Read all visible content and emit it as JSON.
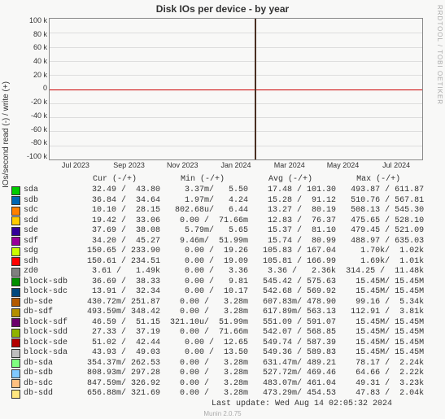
{
  "title": "Disk IOs per device - by year",
  "watermark": "RRDTOOL / TOBI OETIKER",
  "ylabel": "IOs/second read (-) / write (+)",
  "footer": "Munin 2.0.75",
  "last_update": "Last update: Wed Aug 14 02:05:32 2024",
  "chart_data": {
    "type": "line",
    "title": "Disk IOs per device - by year",
    "xlabel": "",
    "ylabel": "IOs/second read (-) / write (+)",
    "ylim": [
      -100000,
      100000
    ],
    "x_ticks": [
      "Jul 2023",
      "Sep 2023",
      "Nov 2023",
      "Jan 2024",
      "Mar 2024",
      "May 2024",
      "Jul 2024"
    ],
    "y_ticks": [
      "100 k",
      "80 k",
      "60 k",
      "40 k",
      "20 k",
      "0",
      "-20 k",
      "-40 k",
      "-60 k",
      "-80 k",
      "-100 k"
    ],
    "series": [
      {
        "name": "sda",
        "color": "#00cc00",
        "cur": "32.49 /  43.80",
        "min": "3.37m/   5.50",
        "avg": "17.48 / 101.30",
        "max": "493.87 / 611.87"
      },
      {
        "name": "sdb",
        "color": "#0066b3",
        "cur": "36.84 /  34.64",
        "min": "1.97m/   4.24",
        "avg": "15.28 /  91.12",
        "max": "510.76 / 567.81"
      },
      {
        "name": "sdc",
        "color": "#ff8000",
        "cur": "10.10 /  28.15",
        "min": "802.68u/   6.44",
        "avg": "13.27 /  80.19",
        "max": "508.13 / 545.30"
      },
      {
        "name": "sdd",
        "color": "#ffcc00",
        "cur": "19.42 /  33.06",
        "min": "0.00 /  71.66m",
        "avg": "12.83 /  76.37",
        "max": "475.65 / 528.10"
      },
      {
        "name": "sde",
        "color": "#330099",
        "cur": "37.69 /  38.08",
        "min": "5.79m/   5.65",
        "avg": "15.37 /  81.10",
        "max": "479.45 / 521.09"
      },
      {
        "name": "sdf",
        "color": "#990099",
        "cur": "34.20 /  45.27",
        "min": "9.46m/  51.99m",
        "avg": "15.74 /  80.99",
        "max": "488.97 / 635.03"
      },
      {
        "name": "sdg",
        "color": "#ccff00",
        "cur": "150.65 / 233.90",
        "min": "0.00 /  19.26",
        "avg": "105.83 / 167.04",
        "max": "1.70k/  1.02k"
      },
      {
        "name": "sdh",
        "color": "#ff0000",
        "cur": "150.61 / 234.51",
        "min": "0.00 /  19.09",
        "avg": "105.81 / 166.99",
        "max": "1.69k/  1.01k"
      },
      {
        "name": "zd0",
        "color": "#808080",
        "cur": "3.61 /   1.49k",
        "min": "0.00 /   3.36",
        "avg": "3.36 /   2.36k",
        "max": "314.25 /  11.48k"
      },
      {
        "name": "block-sdb",
        "color": "#008f00",
        "cur": "36.69 /  38.33",
        "min": "0.00 /   9.81",
        "avg": "545.42 / 575.63",
        "max": "15.45M/ 15.45M"
      },
      {
        "name": "block-sdc",
        "color": "#00487d",
        "cur": "13.91 /  32.34",
        "min": "0.00 /  10.17",
        "avg": "542.68 / 569.92",
        "max": "15.45M/ 15.45M"
      },
      {
        "name": "db-sde",
        "color": "#b35a00",
        "cur": "430.72m/ 251.87",
        "min": "0.00 /   3.28m",
        "avg": "607.83m/ 478.90",
        "max": "99.16 /  5.34k"
      },
      {
        "name": "db-sdf",
        "color": "#b38f00",
        "cur": "493.59m/ 348.42",
        "min": "0.00 /   3.28m",
        "avg": "617.89m/ 563.13",
        "max": "112.91 /  3.81k"
      },
      {
        "name": "block-sdf",
        "color": "#6b006b",
        "cur": "46.59 /  51.15",
        "min": "321.10u/  51.99m",
        "avg": "551.09 / 591.07",
        "max": "15.45M/ 15.45M"
      },
      {
        "name": "block-sdd",
        "color": "#8fb300",
        "cur": "27.33 /  37.19",
        "min": "0.00 /  71.66m",
        "avg": "542.07 / 568.85",
        "max": "15.45M/ 15.45M"
      },
      {
        "name": "block-sde",
        "color": "#b30000",
        "cur": "51.02 /  42.44",
        "min": "0.00 /  12.65",
        "avg": "549.74 / 587.39",
        "max": "15.45M/ 15.45M"
      },
      {
        "name": "block-sda",
        "color": "#bebebe",
        "cur": "43.93 /  49.03",
        "min": "0.00 /  13.50",
        "avg": "549.36 / 589.83",
        "max": "15.45M/ 15.45M"
      },
      {
        "name": "db-sda",
        "color": "#80ff80",
        "cur": "354.37m/ 262.53",
        "min": "0.00 /   3.28m",
        "avg": "631.47m/ 489.21",
        "max": "78.17 /  2.24k"
      },
      {
        "name": "db-sdb",
        "color": "#80c9ff",
        "cur": "808.93m/ 297.28",
        "min": "0.00 /   3.28m",
        "avg": "527.72m/ 469.46",
        "max": "64.66 /  2.22k"
      },
      {
        "name": "db-sdc",
        "color": "#ffc080",
        "cur": "847.59m/ 326.92",
        "min": "0.00 /   3.28m",
        "avg": "483.07m/ 461.04",
        "max": "49.31 /  3.23k"
      },
      {
        "name": "db-sdd",
        "color": "#ffe680",
        "cur": "656.88m/ 321.69",
        "min": "0.00 /   3.28m",
        "avg": "473.29m/ 454.53",
        "max": "47.83 /  2.04k"
      }
    ]
  },
  "legend_header": "              Cur (-/+)         Min (-/+)         Avg (-/+)         Max (-/+)"
}
